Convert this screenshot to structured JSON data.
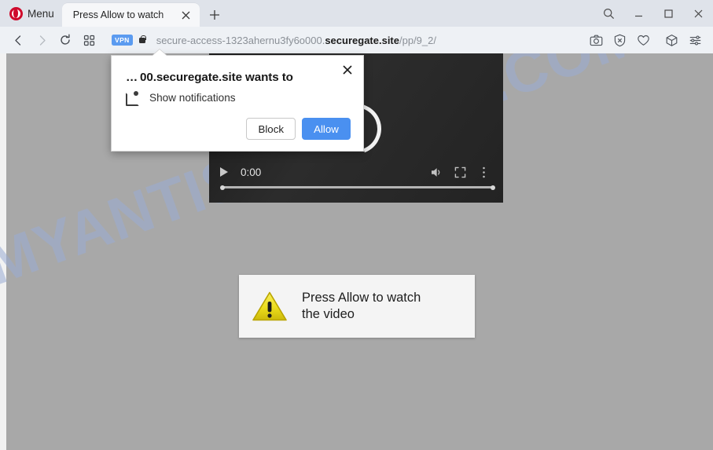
{
  "browser": {
    "menu_label": "Menu",
    "logo_icon": "opera-logo-icon",
    "tab": {
      "title": "Press Allow to watch",
      "close_icon": "close-icon"
    },
    "new_tab_icon": "plus-icon",
    "window_controls": {
      "search_icon": "search-icon",
      "minimize_icon": "minimize-icon",
      "maximize_icon": "maximize-icon",
      "close_icon": "close-icon"
    },
    "toolbar": {
      "back_icon": "chevron-left-icon",
      "forward_icon": "chevron-right-icon",
      "reload_icon": "reload-icon",
      "speeddial_icon": "grid-icon",
      "vpn_badge": "VPN",
      "lock_icon": "lock-icon",
      "url_prefix": "secure-access-1323ahernu3fy6o000.",
      "url_domain": "securegate.site",
      "url_path": "/pp/9_2/",
      "right_icons": [
        "camera-icon",
        "ad-blocker-shield-icon",
        "heart-icon",
        "cube-icon",
        "easy-setup-sliders-icon"
      ]
    }
  },
  "permission_dialog": {
    "title": "… 00.securegate.site wants to",
    "permission_icon": "notification-popup-icon",
    "permission_label": "Show notifications",
    "close_icon": "close-icon",
    "block_label": "Block",
    "allow_label": "Allow",
    "allow_color": "#4a90f0"
  },
  "page": {
    "watermark": "MYANTISPYWARE.COM",
    "watermark_color": "#9aadd4",
    "background_color": "#a8a8a8",
    "video_player": {
      "spinner_icon": "loading-spinner-icon",
      "play_icon": "play-icon",
      "time": "0:00",
      "volume_icon": "volume-icon",
      "fullscreen_icon": "fullscreen-icon",
      "more_icon": "more-vertical-icon",
      "progress_percent": 0
    },
    "warning_card": {
      "warning_icon": "warning-triangle-icon",
      "warning_color": "#e8d41a",
      "line1": "Press Allow to watch",
      "line2": "the video"
    }
  }
}
